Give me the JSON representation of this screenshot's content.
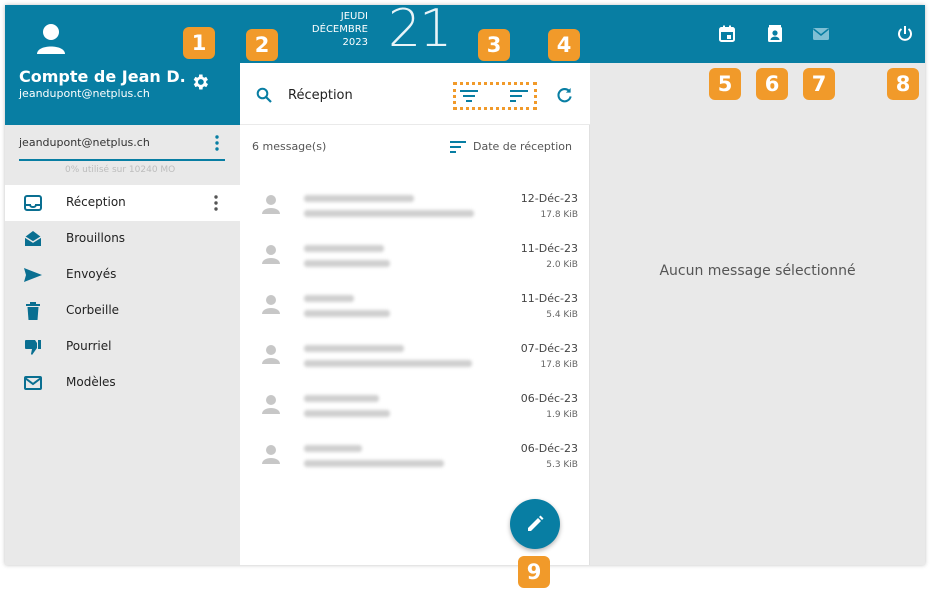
{
  "account": {
    "name": "Compte de Jean D.",
    "email": "jeandupont@netplus.ch",
    "address_row": "jeandupont@netplus.ch",
    "quota": "0% utilisé sur 10240 MO"
  },
  "folders": [
    {
      "label": "Réception",
      "icon": "inbox-icon",
      "active": true
    },
    {
      "label": "Brouillons",
      "icon": "drafts-icon"
    },
    {
      "label": "Envoyés",
      "icon": "send-icon"
    },
    {
      "label": "Corbeille",
      "icon": "trash-icon"
    },
    {
      "label": "Pourriel",
      "icon": "thumb-down-icon"
    },
    {
      "label": "Modèles",
      "icon": "envelope-icon"
    }
  ],
  "date": {
    "weekday": "JEUDI",
    "month": "DÉCEMBRE",
    "year": "2023",
    "day": "21"
  },
  "list": {
    "title": "Réception",
    "count": "6 message(s)",
    "sort_label": "Date de réception"
  },
  "messages": [
    {
      "date": "12-Déc-23",
      "size": "17.8 KiB"
    },
    {
      "date": "11-Déc-23",
      "size": "2.0 KiB"
    },
    {
      "date": "11-Déc-23",
      "size": "5.4 KiB"
    },
    {
      "date": "07-Déc-23",
      "size": "17.8 KiB"
    },
    {
      "date": "06-Déc-23",
      "size": "1.9 KiB"
    },
    {
      "date": "06-Déc-23",
      "size": "5.3 KiB"
    }
  ],
  "preview": {
    "empty": "Aucun message sélectionné"
  },
  "badges": [
    "1",
    "2",
    "3",
    "4",
    "5",
    "6",
    "7",
    "8",
    "9"
  ],
  "colors": {
    "primary": "#087ea3",
    "badge": "#f19a2a"
  }
}
